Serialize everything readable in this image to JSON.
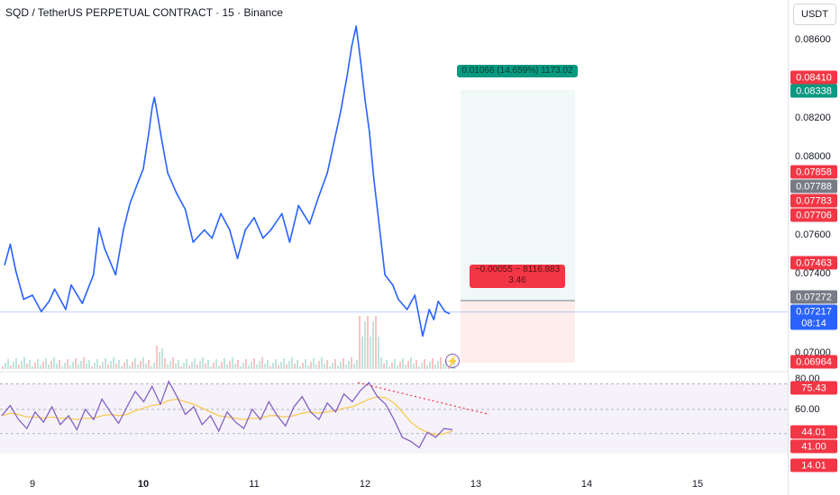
{
  "header": {
    "title": "SQD / TetherUS PERPETUAL CONTRACT · 15 · Binance",
    "currency": "USDT"
  },
  "colors": {
    "price_line": "#2962ff",
    "rsi_line": "#7e57c2",
    "rsi_ma": "#f7c948",
    "profit": "#089981",
    "loss": "#f23645",
    "trend": "#f23645"
  },
  "price_axis": {
    "labels": [
      "0.08600",
      "0.08200",
      "0.08000",
      "0.07600",
      "0.07400",
      "0.07000"
    ],
    "tags": [
      {
        "value": "0.08410",
        "color": "#f23645"
      },
      {
        "value": "0.08338",
        "color": "#089981"
      },
      {
        "value": "0.07858",
        "color": "#f23645"
      },
      {
        "value": "0.07788",
        "color": "#787b86"
      },
      {
        "value": "0.07783",
        "color": "#f23645"
      },
      {
        "value": "0.07706",
        "color": "#f23645"
      },
      {
        "value": "0.07463",
        "color": "#f23645"
      },
      {
        "value": "0.07272",
        "color": "#787b86"
      },
      {
        "value": "0.07217",
        "color": "#2962ff"
      },
      {
        "value": "0.06964",
        "color": "#f23645"
      }
    ],
    "countdown": "08:14"
  },
  "rsi_axis": {
    "labels": [
      "80.00",
      "60.00"
    ],
    "tags": [
      {
        "value": "75.43",
        "color": "#f23645"
      },
      {
        "value": "44.01",
        "color": "#f23645"
      },
      {
        "value": "41.00",
        "color": "#f23645"
      },
      {
        "value": "14.01",
        "color": "#f23645"
      }
    ]
  },
  "x_axis": {
    "labels": [
      {
        "text": "9",
        "bold": false
      },
      {
        "text": "10",
        "bold": true
      },
      {
        "text": "11",
        "bold": false
      },
      {
        "text": "12",
        "bold": false
      },
      {
        "text": "13",
        "bold": false
      },
      {
        "text": "14",
        "bold": false
      },
      {
        "text": "15",
        "bold": false
      }
    ]
  },
  "position": {
    "profit_label": "0.01066 (14.659%) 1173.02",
    "loss_label_line1": "−0.00055 − 8116.883",
    "loss_label_line2": "3.46"
  },
  "chart_data": {
    "type": "line",
    "title": "SQD / TetherUS PERPETUAL CONTRACT · 15 · Binance",
    "xlabel": "",
    "ylabel": "",
    "x_ticks": [
      "9",
      "10",
      "11",
      "12",
      "13",
      "14",
      "15"
    ],
    "ylim": [
      0.0696,
      0.0866
    ],
    "series": [
      {
        "x": [
          8.75,
          8.8,
          8.85,
          8.92,
          9.0,
          9.08,
          9.15,
          9.2,
          9.3,
          9.35,
          9.45,
          9.55,
          9.6,
          9.65,
          9.75,
          9.82,
          9.88,
          9.95,
          10.0,
          10.05,
          10.08,
          10.1,
          10.12,
          10.17,
          10.22,
          10.3,
          10.38,
          10.45,
          10.55,
          10.62,
          10.7,
          10.78,
          10.85,
          10.92,
          11.0,
          11.08,
          11.15,
          11.25,
          11.32,
          11.4,
          11.5,
          11.58,
          11.66,
          11.72,
          11.78,
          11.84,
          11.88,
          11.92,
          11.96,
          12.0,
          12.04,
          12.08,
          12.12,
          12.18,
          12.25,
          12.3,
          12.38,
          12.45,
          12.52,
          12.58,
          12.62,
          12.66,
          12.72,
          12.76
        ],
        "y": [
          0.0745,
          0.0755,
          0.0742,
          0.0728,
          0.073,
          0.0722,
          0.0727,
          0.0733,
          0.0723,
          0.0735,
          0.0726,
          0.074,
          0.0763,
          0.0753,
          0.074,
          0.0762,
          0.0775,
          0.0785,
          0.0792,
          0.081,
          0.0822,
          0.0827,
          0.0821,
          0.0805,
          0.079,
          0.078,
          0.0772,
          0.0756,
          0.0762,
          0.0758,
          0.077,
          0.0762,
          0.0748,
          0.0762,
          0.0768,
          0.0758,
          0.0762,
          0.077,
          0.0756,
          0.0774,
          0.0765,
          0.0778,
          0.079,
          0.0805,
          0.082,
          0.0838,
          0.0852,
          0.0862,
          0.0845,
          0.0826,
          0.081,
          0.0787,
          0.0768,
          0.074,
          0.0735,
          0.0728,
          0.0723,
          0.073,
          0.071,
          0.0723,
          0.0718,
          0.0727,
          0.0722,
          0.0721
        ]
      }
    ],
    "rsi": {
      "levels": [
        80,
        60,
        41
      ],
      "ylim": [
        14,
        86
      ],
      "values": [
        55,
        63,
        52,
        45,
        58,
        50,
        62,
        48,
        55,
        44,
        60,
        52,
        68,
        58,
        49,
        62,
        74,
        66,
        78,
        64,
        82,
        70,
        56,
        62,
        48,
        55,
        43,
        58,
        50,
        45,
        60,
        52,
        66,
        55,
        47,
        62,
        70,
        58,
        52,
        65,
        58,
        72,
        66,
        75,
        81,
        70,
        64,
        52,
        38,
        35,
        30,
        42,
        38,
        45,
        44
      ],
      "ma_values": [
        55,
        57,
        56,
        54,
        54,
        53,
        54,
        53,
        53,
        52,
        53,
        53,
        55,
        56,
        55,
        56,
        59,
        61,
        63,
        64,
        67,
        68,
        66,
        64,
        61,
        58,
        55,
        54,
        53,
        52,
        53,
        53,
        55,
        55,
        54,
        55,
        57,
        58,
        57,
        58,
        59,
        61,
        62,
        65,
        68,
        70,
        69,
        65,
        58,
        50,
        45,
        42,
        40,
        41,
        43
      ]
    }
  }
}
